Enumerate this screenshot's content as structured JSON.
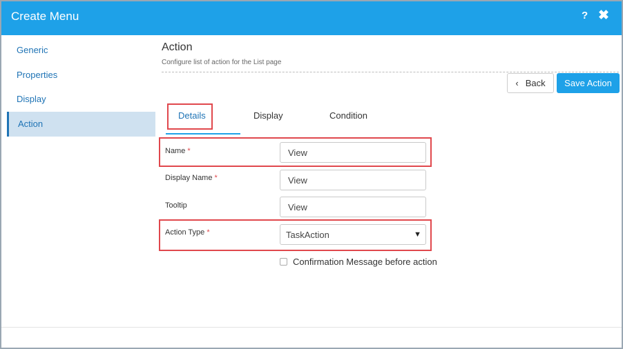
{
  "dialog": {
    "title": "Create Menu",
    "help_icon": "?",
    "close_icon": "✖"
  },
  "sidebar": {
    "items": [
      {
        "label": "Generic"
      },
      {
        "label": "Properties"
      },
      {
        "label": "Display"
      },
      {
        "label": "Action",
        "active": true
      }
    ]
  },
  "section": {
    "title": "Action",
    "subtitle": "Configure list of action for the List page"
  },
  "buttons": {
    "back_icon": "‹",
    "back_label": "Back",
    "save_label": "Save Action"
  },
  "tabs": [
    {
      "label": "Details",
      "active": true
    },
    {
      "label": "Display"
    },
    {
      "label": "Condition"
    }
  ],
  "form": {
    "name": {
      "label": "Name",
      "required": "*",
      "value": "View"
    },
    "display_name": {
      "label": "Display Name",
      "required": "*",
      "value": "View"
    },
    "tooltip": {
      "label": "Tooltip",
      "value": "View"
    },
    "action_type": {
      "label": "Action Type",
      "required": "*",
      "value": "TaskAction"
    },
    "confirmation": {
      "label": "Confirmation Message before action",
      "checked": false
    }
  },
  "colors": {
    "accent": "#1ea1e8",
    "highlight": "#e0474c",
    "sidebar_active_bg": "#cfe1f0"
  }
}
